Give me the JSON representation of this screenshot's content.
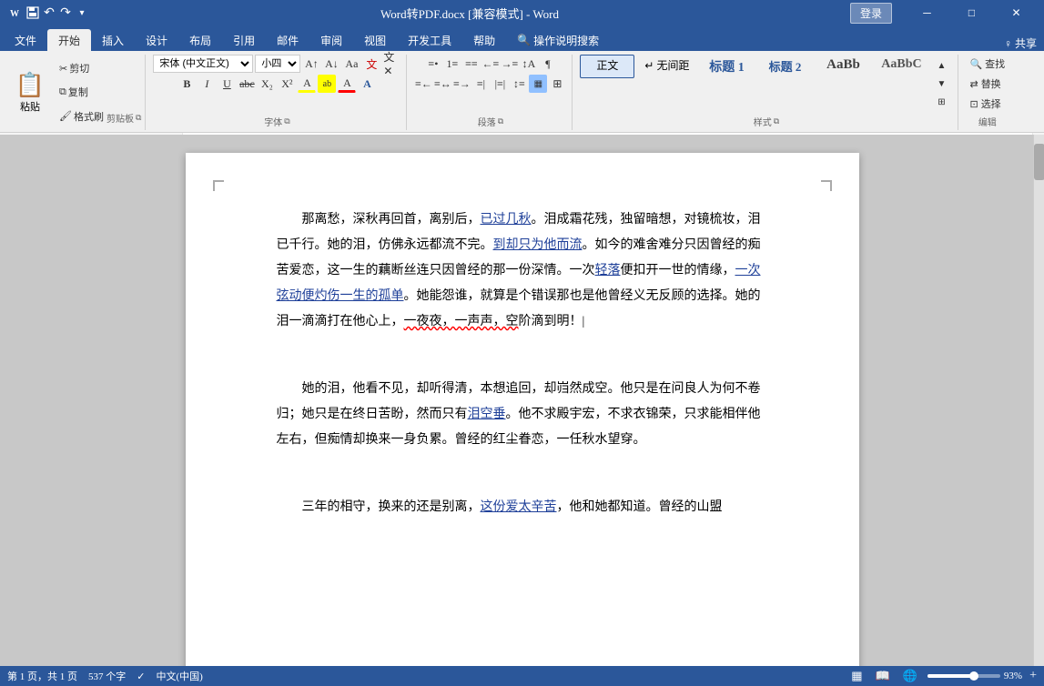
{
  "titleBar": {
    "title": "Word转PDF.docx [兼容模式] - Word",
    "loginBtn": "登录",
    "shareBtn": "♀ 共享"
  },
  "ribbonTabs": {
    "tabs": [
      "文件",
      "开始",
      "插入",
      "设计",
      "布局",
      "引用",
      "邮件",
      "审阅",
      "视图",
      "开发工具",
      "帮助",
      "♀ 操作说明搜索"
    ]
  },
  "clipboard": {
    "pasteLabel": "粘贴",
    "cutLabel": "剪切",
    "copyLabel": "复制",
    "formatLabel": "格式刷",
    "groupLabel": "剪贴板"
  },
  "font": {
    "fontName": "宋体 (中文正文)",
    "fontSize": "小四",
    "groupLabel": "字体"
  },
  "paragraph": {
    "groupLabel": "段落"
  },
  "styles": {
    "items": [
      "正文",
      "↵ 无间距",
      "标题 1",
      "标题 2"
    ],
    "groupLabel": "样式"
  },
  "editing": {
    "findLabel": "查找",
    "replaceLabel": "替换",
    "selectLabel": "选择",
    "groupLabel": "编辑"
  },
  "document": {
    "paragraphs": [
      "那离愁，深秋再回首，离别后，已过几秋。泪成霜花残，独留暗想，对镜梳妆，泪已千行。她的泪，仿佛永远都流不完。到却只为他而流。如今的难舍难分只因曾经的痴苦爱恋，这一生的藕断丝连只因曾经的那一份深情。一次轻落便扣开一世的情缘，一次弦动便灼伤一生的孤单。她能怨谁，就算是个错误那也是他曾经义无反顾的选择。她的泪一滴滴打在他心上，一夜夜，一声声，空阶滴到明！",
      "她的泪，他看不见，却听得清，本想追回，却岿然成空。他只是在问良人为何不卷归；她只是在终日苦盼，然而只有泪空垂。他不求殿宇宏，不求衣锦荣，只求能相伴他左右，但痴情却换来一身负累。曾经的红尘眷恋，一任秋水望穿。",
      "三年的相守，换来的还是别离，这份爱太辛苦，他和她都知道。曾经的山盟"
    ],
    "specialUnderlines": [
      "已过几秋",
      "到却只为他而流",
      "一次轻落",
      "一次弦动便灼伤一生的孤单",
      "一夜夜，一声声，空",
      "泪空垂",
      "这份爱太辛苦"
    ]
  },
  "statusBar": {
    "pageInfo": "第 1 页，共 1 页",
    "wordCount": "537 个字",
    "lang": "中文(中国)",
    "zoom": "93%"
  }
}
